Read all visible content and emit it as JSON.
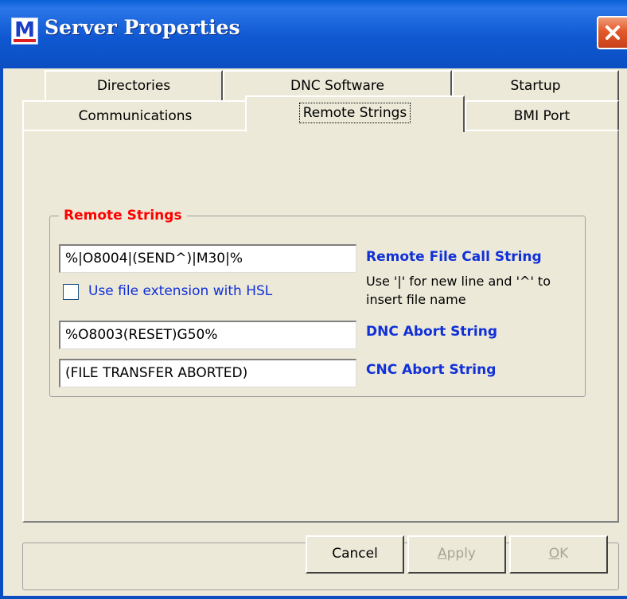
{
  "window": {
    "title": "Server Properties",
    "app_icon_glyph": "M",
    "close_icon": "close-icon"
  },
  "tabs": {
    "row1": [
      {
        "label": "Directories"
      },
      {
        "label": "DNC Software"
      },
      {
        "label": "Startup"
      }
    ],
    "row2": [
      {
        "label": "Communications"
      },
      {
        "label": "Remote Strings",
        "active": true
      },
      {
        "label": "BMI Port"
      }
    ]
  },
  "remote_strings": {
    "group_title": "Remote Strings",
    "file_call_value": "%|O8004|(SEND^)|M30|%",
    "file_call_label": "Remote File Call String",
    "file_call_hint": "Use '|' for new line and '^' to insert file name",
    "use_extension_label": "Use file extension with HSL",
    "use_extension_checked": false,
    "dnc_abort_value": "%O8003(RESET)G50%",
    "dnc_abort_label": "DNC Abort String",
    "cnc_abort_value": "(FILE TRANSFER ABORTED)",
    "cnc_abort_label": "CNC Abort String"
  },
  "buttons": {
    "cancel": "Cancel",
    "apply": "Apply",
    "apply_first": "A",
    "apply_rest": "pply",
    "ok_first": "O",
    "ok_rest": "K"
  },
  "colors": {
    "titlebar": "#0b4ec2",
    "group_title": "#ff0000",
    "field_label": "#1030d8",
    "face": "#ece9d8"
  }
}
